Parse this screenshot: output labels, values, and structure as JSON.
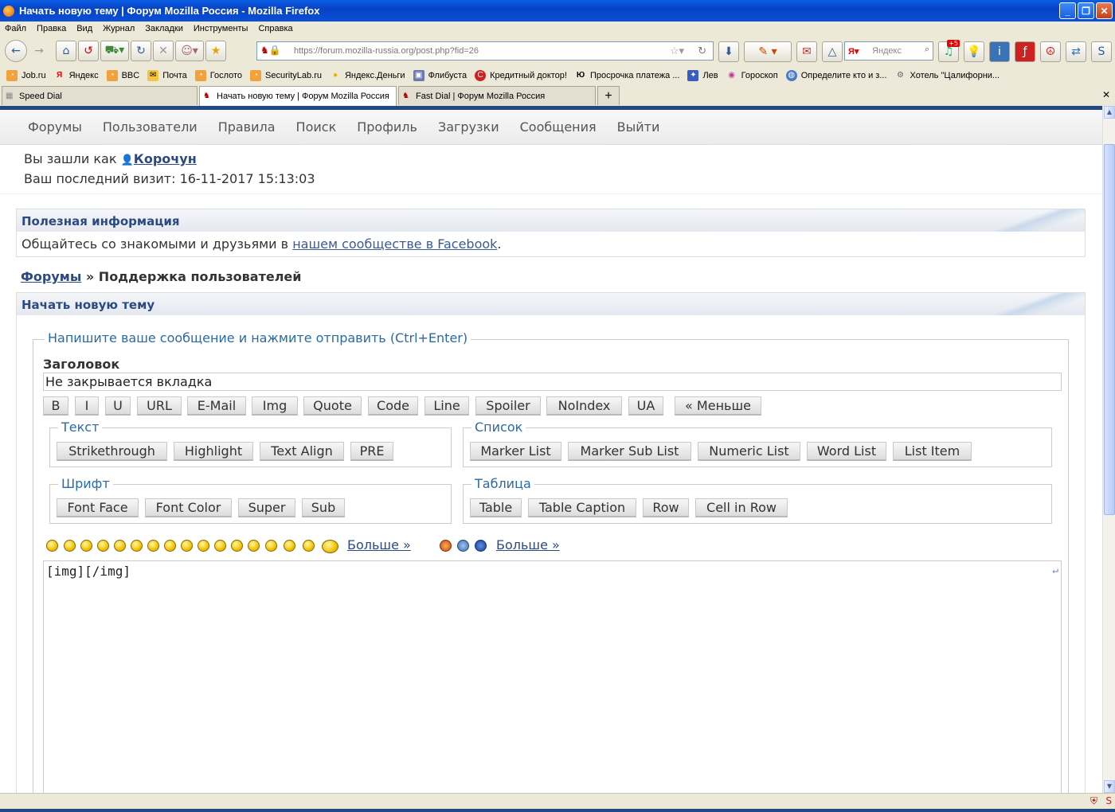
{
  "window": {
    "title": "Начать новую тему | Форум Mozilla Россия - Mozilla Firefox"
  },
  "menu": [
    "Файл",
    "Правка",
    "Вид",
    "Журнал",
    "Закладки",
    "Инструменты",
    "Справка"
  ],
  "url": "https://forum.mozilla-russia.org/post.php?fid=26",
  "search_placeholder": "Яндекс",
  "badge": "+5",
  "bookmarks": [
    "Job.ru",
    "Яндекс",
    "BBC",
    "Почта",
    "Гослото",
    "SecurityLab.ru",
    "Яндекс.Деньги",
    "Флибуста",
    "Кредитный доктор!",
    "Просрочка платежа ...",
    "Лев",
    "Гороскоп",
    "Определите кто и з...",
    "Хотель \"Цалифорни..."
  ],
  "tabs": [
    "Speed Dial",
    "Начать новую тему | Форум Mozilla Россия",
    "Fast Dial | Форум Mozilla Россия"
  ],
  "forum_nav": [
    "Форумы",
    "Пользователи",
    "Правила",
    "Поиск",
    "Профиль",
    "Загрузки",
    "Сообщения",
    "Выйти"
  ],
  "user": {
    "logged_prefix": "Вы зашли как",
    "name": "Корочун",
    "last_visit": "Ваш последний визит: 16-11-2017 15:13:03"
  },
  "info_panel": {
    "title": "Полезная информация",
    "text_before": "Общайтесь со знакомыми и друзьями в",
    "link": "нашем сообществе в Facebook",
    "text_after": "."
  },
  "breadcrumb": {
    "root": "Форумы",
    "sep": "»",
    "current": "Поддержка пользователей"
  },
  "post_panel": {
    "title": "Начать новую тему",
    "legend": "Напишите ваше сообщение и нажмите отправить (Ctrl+Enter)"
  },
  "form": {
    "subject_label": "Заголовок",
    "subject_value": "Не закрывается вкладка",
    "message": "[img][/img]"
  },
  "toolbar": [
    "B",
    "I",
    "U",
    "URL",
    "E-Mail",
    "Img",
    "Quote",
    "Code",
    "Line",
    "Spoiler",
    "NoIndex",
    "UA",
    "« Меньше"
  ],
  "groups": {
    "text": {
      "title": "Текст",
      "buttons": [
        "Strikethrough",
        "Highlight",
        "Text Align",
        "PRE"
      ]
    },
    "list": {
      "title": "Список",
      "buttons": [
        "Marker List",
        "Marker Sub List",
        "Numeric List",
        "Word List",
        "List Item"
      ]
    },
    "font": {
      "title": "Шрифт",
      "buttons": [
        "Font Face",
        "Font Color",
        "Super",
        "Sub"
      ]
    },
    "table": {
      "title": "Таблица",
      "buttons": [
        "Table",
        "Table Caption",
        "Row",
        "Cell in Row"
      ]
    }
  },
  "more_smileys": "Больше »",
  "more_icons": "Больше »"
}
